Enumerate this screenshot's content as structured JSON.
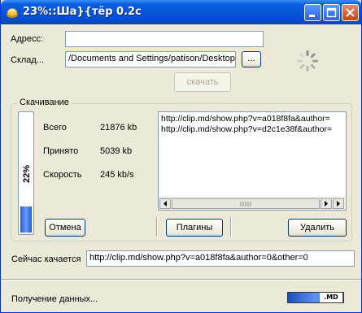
{
  "window": {
    "title": "23%::Ша}{тёр 0.2с",
    "app_icon": "app-icon",
    "controls": [
      "minimize-icon",
      "maximize-icon",
      "close-icon"
    ]
  },
  "form": {
    "address_label": "Адресс:",
    "address_value": "",
    "storage_label": "Склад...",
    "storage_value": "/Documents and Settings/patison/Desktop",
    "browse_label": "...",
    "download_button": "скачать",
    "spinner_icon": "loading-spinner-icon"
  },
  "download": {
    "group_title": "Скачивание",
    "progress_text": "22%",
    "progress_fraction": 0.22,
    "stats": [
      {
        "label": "Всего",
        "value": "21876 kb"
      },
      {
        "label": "Принято",
        "value": "5039 kb"
      },
      {
        "label": "Скорость",
        "value": "245 kb/s"
      }
    ],
    "queue": [
      "http://clip.md/show.php?v=a018f8fa&author=",
      "http://clip.md/show.php?v=d2c1e38f&author="
    ],
    "cancel_button": "Отмена",
    "plugins_button": "Плагины",
    "delete_button": "Удалить"
  },
  "current": {
    "label": "Сейчас качается",
    "value": "http://clip.md/show.php?v=a018f8fa&author=0&other=0"
  },
  "status": {
    "text": "Получение данных...",
    "badge": ".MD"
  },
  "colors": {
    "titlebar": "#0553d6",
    "progress": "#1d5bd6"
  }
}
